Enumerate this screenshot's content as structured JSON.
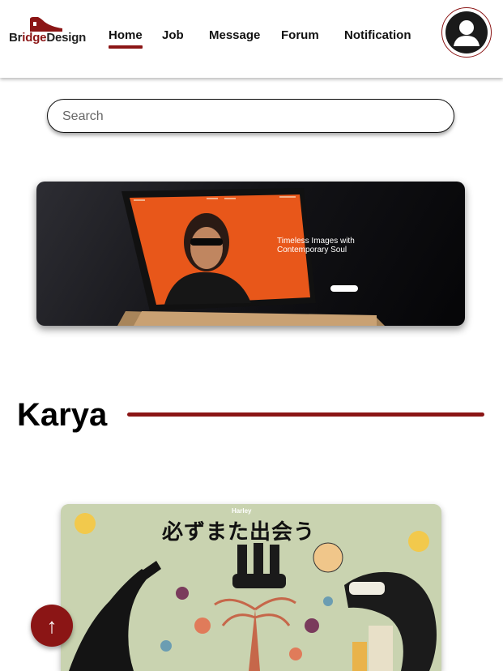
{
  "header": {
    "logo": {
      "part1": "Br",
      "part2": "idge",
      "part3": "Design"
    },
    "nav": [
      {
        "label": "Home",
        "active": true
      },
      {
        "label": "Job",
        "active": false
      },
      {
        "label": "Message",
        "active": false
      },
      {
        "label": "Forum",
        "active": false
      },
      {
        "label": "Notification",
        "active": false
      }
    ],
    "avatar_icon": "user-icon"
  },
  "search": {
    "placeholder": "Search",
    "value": ""
  },
  "banner": {
    "headline": "Timeless Images with Contemporary Soul"
  },
  "section": {
    "title": "Karya"
  },
  "artwork": {
    "brand": "Harley",
    "title": "必ずまた出会う"
  },
  "scroll_top": {
    "icon": "arrow-up-icon",
    "glyph": "↑"
  },
  "colors": {
    "accent": "#8b1515",
    "header_bg": "#ffffff",
    "art_bg": "#c9d3b0"
  }
}
